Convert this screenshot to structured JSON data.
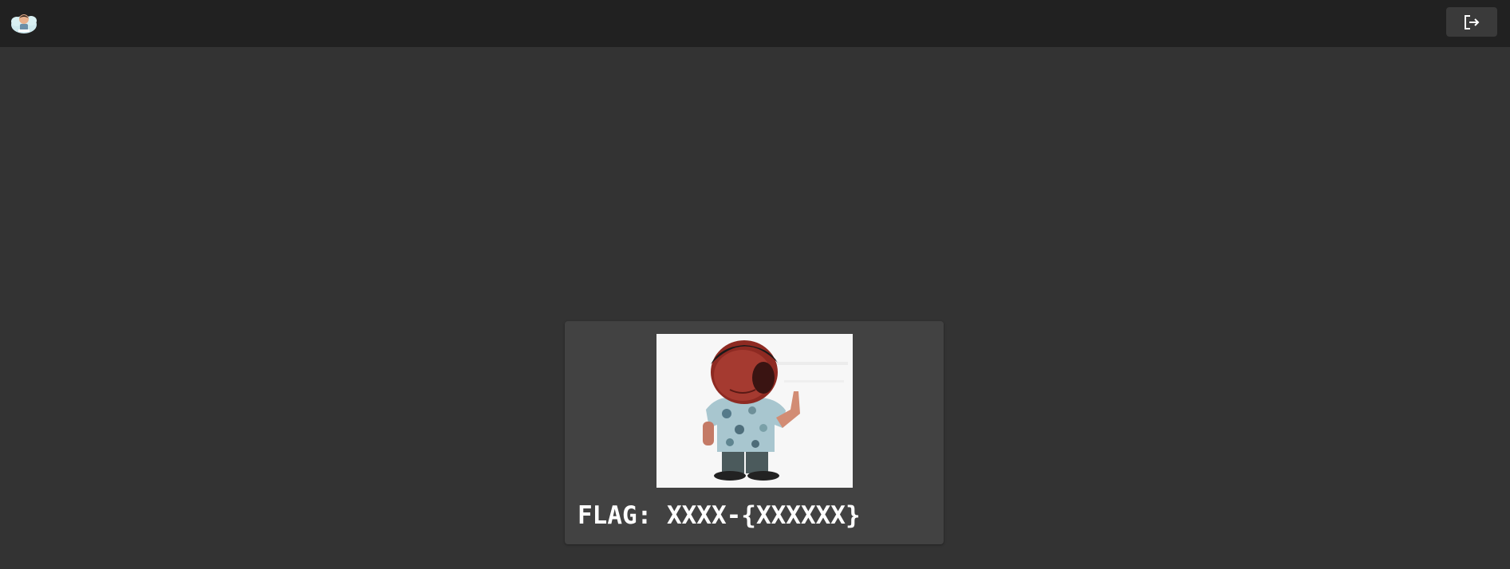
{
  "header": {
    "logo_icon": "avatar-logo-icon",
    "logout_icon": "logout-icon"
  },
  "card": {
    "image_alt": "cartoon-man-pointing",
    "flag_label": "FLAG: XXXX-{XXXXXX}"
  },
  "colors": {
    "page_bg": "#333333",
    "topbar_bg": "#212121",
    "card_bg": "#424242",
    "button_bg": "#3a3a3a",
    "text": "#ffffff"
  }
}
